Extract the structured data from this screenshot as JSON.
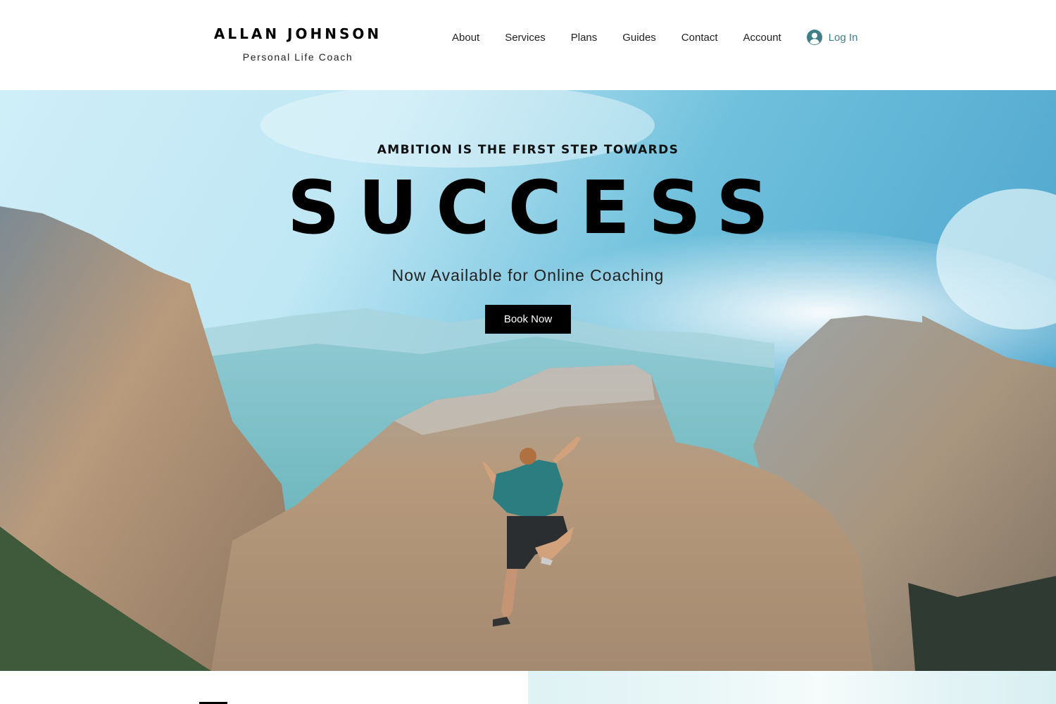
{
  "brand": {
    "name": "ALLAN JOHNSON",
    "subtitle": "Personal Life Coach"
  },
  "nav": {
    "items": [
      {
        "label": "About"
      },
      {
        "label": "Services"
      },
      {
        "label": "Plans"
      },
      {
        "label": "Guides"
      },
      {
        "label": "Contact"
      },
      {
        "label": "Account"
      }
    ],
    "login": {
      "label": "Log In",
      "icon": "user-avatar-icon"
    }
  },
  "hero": {
    "tagline": "AMBITION IS THE FIRST STEP TOWARDS",
    "headline": "SUCCESS",
    "subline": "Now Available for Online Coaching",
    "cta_label": "Book Now",
    "image_description": "Rock climber scaling a cliff face among granite mountains under a blue sky"
  },
  "colors": {
    "accent": "#3f7f88",
    "button_bg": "#000000",
    "button_text": "#ffffff"
  }
}
